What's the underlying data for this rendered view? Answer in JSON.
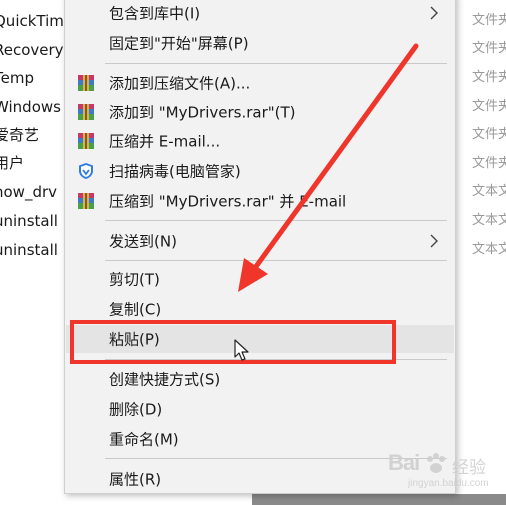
{
  "background": {
    "name_column": [
      {
        "text": "QuickTim"
      },
      {
        "text": "Recovery"
      },
      {
        "text": "Temp"
      },
      {
        "text": "Windows"
      },
      {
        "text": "爱奇艺"
      },
      {
        "text": "用户"
      },
      {
        "text": "how_drv"
      },
      {
        "text": "uninstall"
      },
      {
        "text": "uninstall"
      }
    ],
    "type_column": [
      {
        "text": "文件夹"
      },
      {
        "text": "文件夹"
      },
      {
        "text": "文件夹"
      },
      {
        "text": "文件夹"
      },
      {
        "text": "文件夹"
      },
      {
        "text": "文件夹"
      },
      {
        "text": "文本文"
      },
      {
        "text": "文本文"
      },
      {
        "text": "文本文"
      }
    ]
  },
  "context_menu": {
    "items": [
      {
        "label": "包含到库中(I)",
        "icon": "none",
        "submenu": true
      },
      {
        "label": "固定到\"开始\"屏幕(P)",
        "icon": "none",
        "submenu": false
      },
      {
        "label": "添加到压缩文件(A)...",
        "icon": "winrar-icon",
        "submenu": false
      },
      {
        "label": "添加到 \"MyDrivers.rar\"(T)",
        "icon": "winrar-icon",
        "submenu": false
      },
      {
        "label": "压缩并 E-mail...",
        "icon": "winrar-icon",
        "submenu": false
      },
      {
        "label": "扫描病毒(电脑管家)",
        "icon": "shield-icon",
        "submenu": false
      },
      {
        "label": "压缩到 \"MyDrivers.rar\" 并 E-mail",
        "icon": "winrar-icon",
        "submenu": false
      },
      {
        "label": "发送到(N)",
        "icon": "none",
        "submenu": true
      },
      {
        "label": "剪切(T)",
        "icon": "none",
        "submenu": false
      },
      {
        "label": "复制(C)",
        "icon": "none",
        "submenu": false
      },
      {
        "label": "粘贴(P)",
        "icon": "none",
        "submenu": false,
        "highlighted": true
      },
      {
        "label": "创建快捷方式(S)",
        "icon": "none",
        "submenu": false
      },
      {
        "label": "删除(D)",
        "icon": "none",
        "submenu": false
      },
      {
        "label": "重命名(M)",
        "icon": "none",
        "submenu": false
      },
      {
        "label": "属性(R)",
        "icon": "none",
        "submenu": false
      }
    ]
  },
  "watermark": {
    "logo": "Bai",
    "text": "经验",
    "url": "jingyan.baidu.com"
  },
  "colors": {
    "annotation_red": "#f0352b",
    "menu_bg": "#f2f2f2",
    "hover_bg": "#e4e4e4",
    "shield_blue": "#2f7de1"
  }
}
